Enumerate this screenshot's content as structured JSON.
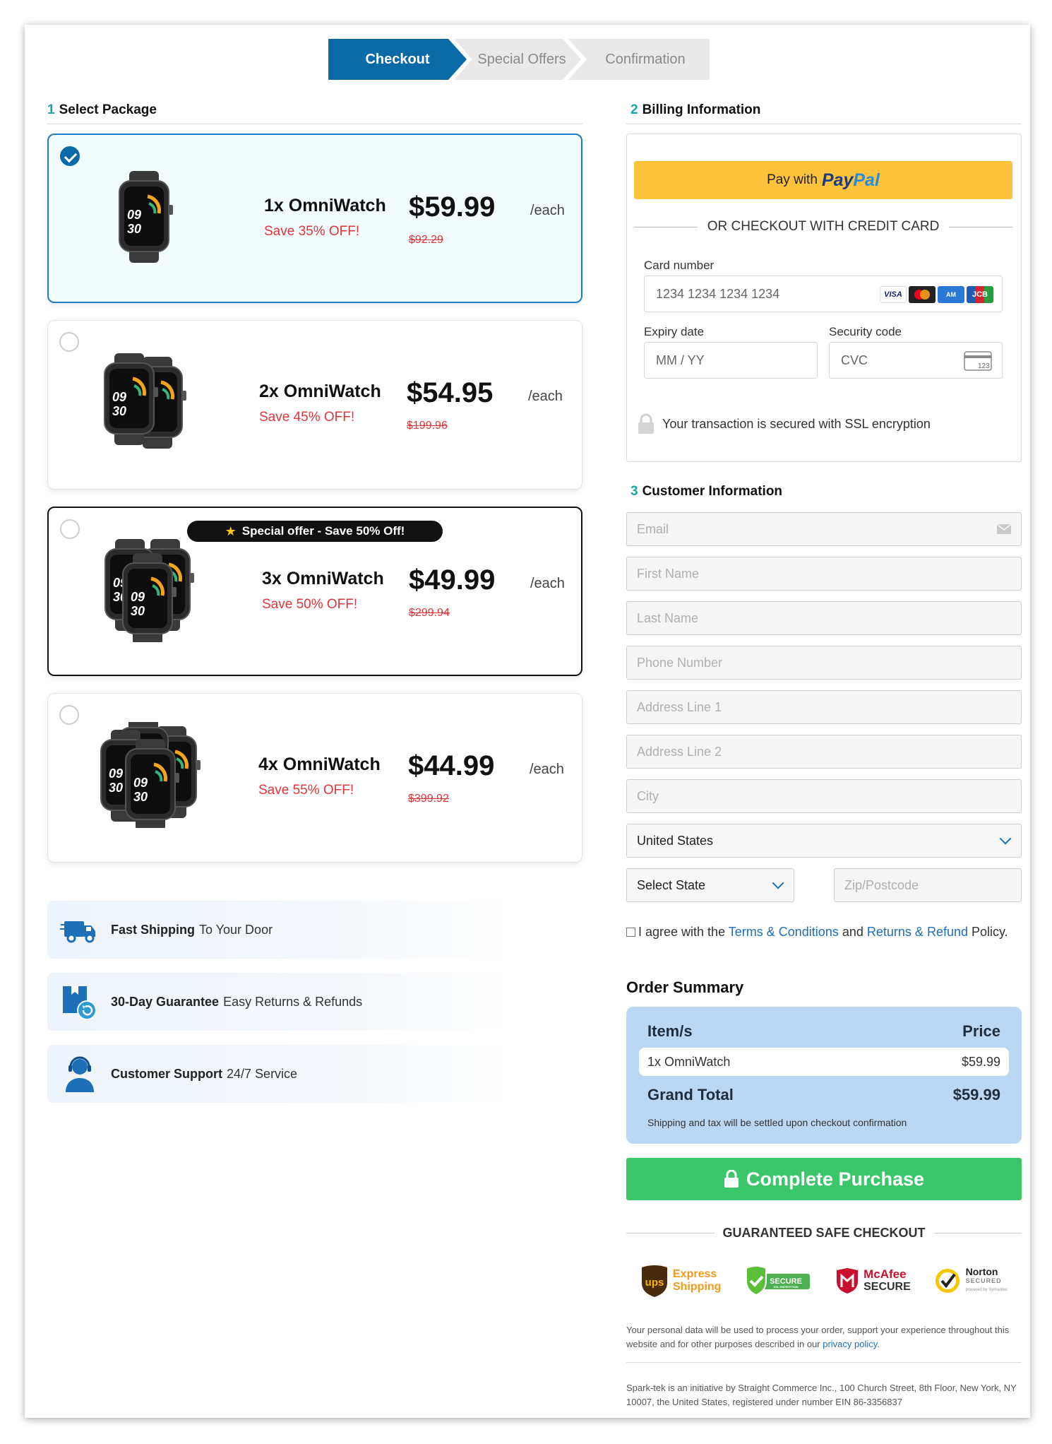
{
  "steps": [
    "Checkout",
    "Special Offers",
    "Confirmation"
  ],
  "select_package": {
    "num": "1",
    "title": "Select Package"
  },
  "packages": [
    {
      "name": "1x OmniWatch",
      "save": "Save 35% OFF!",
      "price": "$59.99",
      "each": "/each",
      "old": "$92.29",
      "selected": true
    },
    {
      "name": "2x OmniWatch",
      "save": "Save 45% OFF!",
      "price": "$54.95",
      "each": "/each",
      "old": "$199.96",
      "selected": false
    },
    {
      "name": "3x OmniWatch",
      "save": "Save 50% OFF!",
      "price": "$49.99",
      "each": "/each",
      "old": "$299.94",
      "selected": false
    },
    {
      "name": "4x OmniWatch",
      "save": "Save 55% OFF!",
      "price": "$44.99",
      "each": "/each",
      "old": "$399.92",
      "selected": false
    }
  ],
  "watch_face": {
    "hour": "09",
    "minute": "30"
  },
  "special_badge": "Special offer - Save 50% Off!",
  "perks": [
    {
      "bold": "Fast Shipping",
      "text": "To Your Door"
    },
    {
      "bold": "30-Day Guarantee",
      "text": "Easy Returns & Refunds"
    },
    {
      "bold": "Customer Support",
      "text": "24/7 Service"
    }
  ],
  "billing": {
    "num": "2",
    "title": "Billing Information",
    "paypal_prefix": "Pay with",
    "paypal_word1": "Pay",
    "paypal_word2": "Pal",
    "or_text": "OR CHECKOUT WITH CREDIT CARD",
    "card_label": "Card number",
    "card_placeholder": "1234 1234 1234 1234",
    "card_brands": [
      "VISA",
      "MC",
      "AMEX",
      "JCB"
    ],
    "expiry_label": "Expiry date",
    "expiry_placeholder": "MM / YY",
    "cvc_label": "Security code",
    "cvc_placeholder": "CVC",
    "cvc_card_num": "123",
    "secure_text": "Your transaction is secured with SSL encryption"
  },
  "customer": {
    "num": "3",
    "title": "Customer Information",
    "fields": [
      "Email",
      "First Name",
      "Last Name",
      "Phone Number",
      "Address Line 1",
      "Address Line 2",
      "City"
    ],
    "country": "United States",
    "state": "Select State",
    "zip_placeholder": "Zip/Postcode"
  },
  "agree": {
    "pre": "I agree with the",
    "terms": "Terms & Conditions",
    "and": "and",
    "returns": "Returns & Refund",
    "post": "Policy."
  },
  "order": {
    "title": "Order Summary",
    "col_item": "Item/s",
    "col_price": "Price",
    "item": "1x OmniWatch",
    "item_price": "$59.99",
    "total_label": "Grand Total",
    "total": "$59.99",
    "note": "Shipping and tax will be settled upon checkout confirmation"
  },
  "complete_btn": "Complete Purchase",
  "guaranteed": "GUARANTEED SAFE CHECKOUT",
  "trust_badges": {
    "ups": "ups",
    "ups_line1": "Express",
    "ups_line2": "Shipping",
    "secure": "SECURE",
    "secure_sub": "SSL ENCRYPTION",
    "mcafee1": "McAfee",
    "mcafee2": "SECURE",
    "norton1": "Norton",
    "norton2": "SECURED",
    "norton_sub": "powered by Symantec"
  },
  "privacy": {
    "text": "Your personal data will be used to process your order, support your experience throughout this website and for other purposes described in our",
    "link": "privacy policy."
  },
  "company": "Spark-tek is an initiative by Straight Commerce Inc., 100 Church Street, 8th Floor, New York, NY 10007, the United States, registered under number EIN 86-3356837",
  "colors": {
    "brand_blue": "#0a6aa8",
    "paypal_yellow": "#fec33a",
    "cta_green": "#3cc66b",
    "sale_red": "#e0353a",
    "summary_blue": "#bad8f4"
  }
}
